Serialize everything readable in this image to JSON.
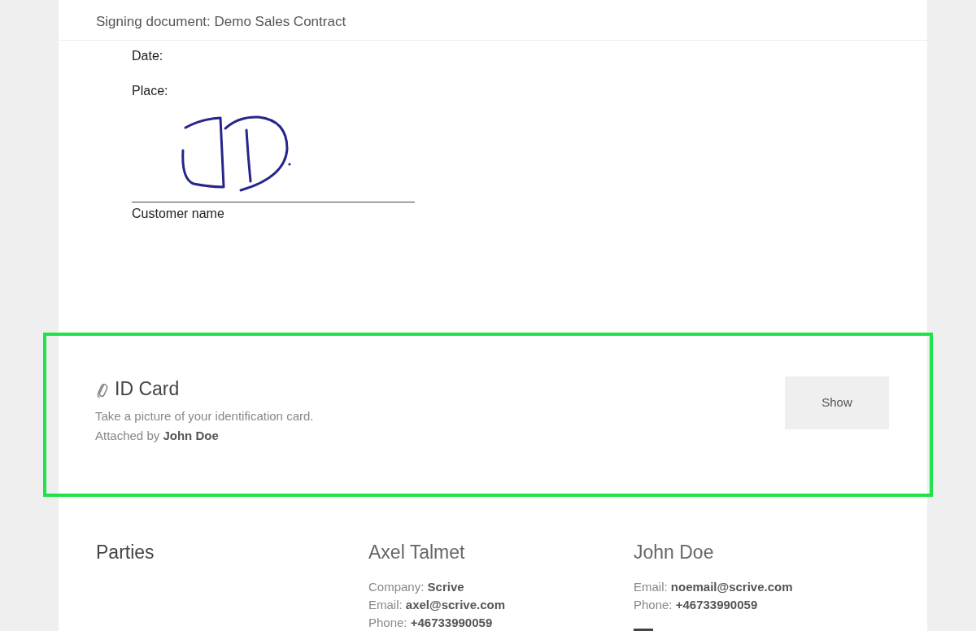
{
  "header": {
    "title": "Signing document: Demo Sales Contract"
  },
  "document": {
    "fields": [
      "Date:",
      "Place:"
    ],
    "signed": true,
    "caption": "Customer name"
  },
  "attachment": {
    "title": "ID Card",
    "description": "Take a picture of your identification card.",
    "attached_by": "Attached by **John Doe**",
    "button": "Show",
    "highlighted": true
  },
  "parties": {
    "heading": "Parties",
    "members": [
      {
        "name": "Axel Talmet",
        "details": [
          "Company: **Scrive**",
          "Email: **axel@scrive.com**",
          "Phone: **+46733990059**"
        ]
      },
      {
        "name": "John Doe",
        "details": [
          "Email: **noemail@scrive.com**",
          "Phone: **+46733990059**"
        ]
      }
    ]
  }
}
